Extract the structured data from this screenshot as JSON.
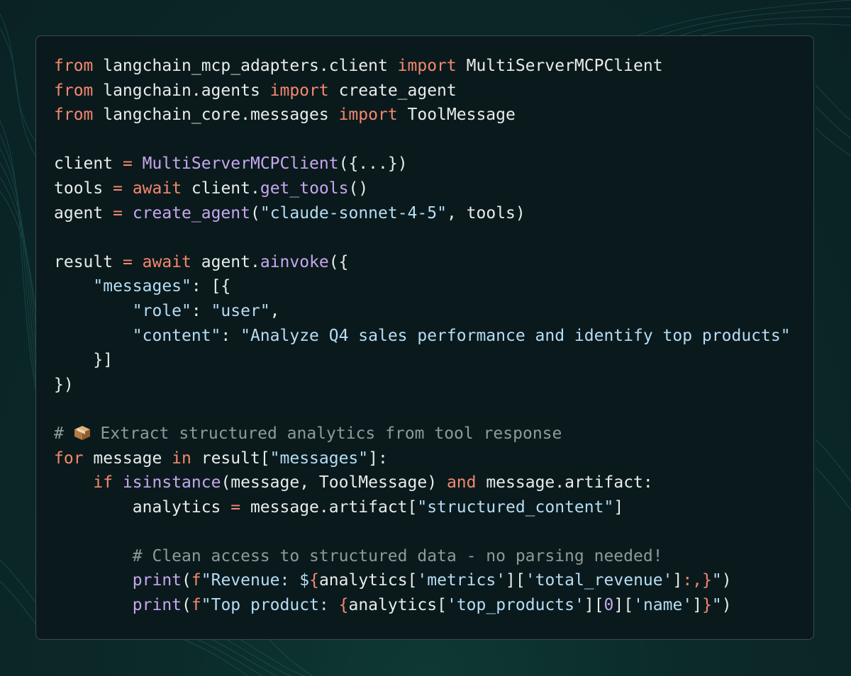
{
  "colors": {
    "background": "#0a2224",
    "card": "#0a1a1c",
    "keyword": "#f5876f",
    "function": "#c8a6f0",
    "string": "#b7dcf5",
    "comment": "#8e9a9a",
    "text": "#e8ecea"
  },
  "icons": [
    "package-icon"
  ],
  "code": {
    "l1": {
      "a": "from",
      "b": " langchain_mcp_adapters.client ",
      "c": "import",
      "d": " MultiServerMCPClient"
    },
    "l2": {
      "a": "from",
      "b": " langchain.agents ",
      "c": "import",
      "d": " create_agent"
    },
    "l3": {
      "a": "from",
      "b": " langchain_core.messages ",
      "c": "import",
      "d": " ToolMessage"
    },
    "l5": {
      "a": "client ",
      "b": "=",
      "c": " ",
      "d": "MultiServerMCPClient",
      "e": "({...})"
    },
    "l6": {
      "a": "tools ",
      "b": "=",
      "c": " ",
      "d": "await",
      "e": " client.",
      "f": "get_tools",
      "g": "()"
    },
    "l7": {
      "a": "agent ",
      "b": "=",
      "c": " ",
      "d": "create_agent",
      "e": "(",
      "f": "\"claude-sonnet-4-5\"",
      "g": ", tools)"
    },
    "l9": {
      "a": "result ",
      "b": "=",
      "c": " ",
      "d": "await",
      "e": " agent.",
      "f": "ainvoke",
      "g": "({"
    },
    "l10": {
      "a": "    ",
      "b": "\"messages\"",
      "c": ": [{"
    },
    "l11": {
      "a": "        ",
      "b": "\"role\"",
      "c": ": ",
      "d": "\"user\"",
      "e": ","
    },
    "l12": {
      "a": "        ",
      "b": "\"content\"",
      "c": ": ",
      "d": "\"Analyze Q4 sales performance and identify top products\""
    },
    "l13": "    }]",
    "l14": "})",
    "l16": {
      "a": "# ",
      "b": " Extract structured analytics from tool response"
    },
    "l17": {
      "a": "for",
      "b": " message ",
      "c": "in",
      "d": " result[",
      "e": "\"messages\"",
      "f": "]:"
    },
    "l18": {
      "a": "    ",
      "b": "if",
      "c": " ",
      "d": "isinstance",
      "e": "(message, ToolMessage) ",
      "f": "and",
      "g": " message.artifact:"
    },
    "l19": {
      "a": "        analytics ",
      "b": "=",
      "c": " message.artifact[",
      "d": "\"structured_content\"",
      "e": "]"
    },
    "l21": {
      "a": "        ",
      "b": "# Clean access to structured data - no parsing needed!"
    },
    "l22": {
      "a": "        ",
      "b": "print",
      "c": "(",
      "d": "f",
      "e": "\"Revenue: $",
      "f": "{",
      "g": "analytics[",
      "h": "'metrics'",
      "i": "][",
      "j": "'total_revenue'",
      "k": "]",
      "l": ":,}",
      "m": "\"",
      "n": ")"
    },
    "l23": {
      "a": "        ",
      "b": "print",
      "c": "(",
      "d": "f",
      "e": "\"Top product: ",
      "f": "{",
      "g": "analytics[",
      "h": "'top_products'",
      "i": "][",
      "j": "0",
      "k": "][",
      "l": "'name'",
      "m": "]",
      "n": "}",
      "o": "\"",
      "p": ")"
    }
  }
}
